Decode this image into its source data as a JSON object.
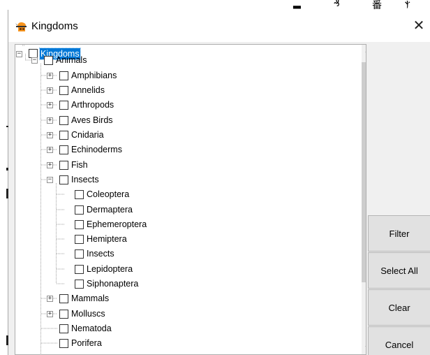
{
  "window": {
    "title": "Kingdoms",
    "close_glyph": "✕"
  },
  "tree": {
    "nodes": [
      {
        "label": "Kingdoms",
        "expander": "minus",
        "selected": true
      },
      {
        "label": "Animals",
        "expander": "minus"
      },
      {
        "label": "Amphibians",
        "expander": "plus"
      },
      {
        "label": "Annelids",
        "expander": "plus"
      },
      {
        "label": "Arthropods",
        "expander": "plus"
      },
      {
        "label": "Aves Birds",
        "expander": "plus"
      },
      {
        "label": "Cnidaria",
        "expander": "plus"
      },
      {
        "label": "Echinoderms",
        "expander": "plus"
      },
      {
        "label": "Fish",
        "expander": "plus"
      },
      {
        "label": "Insects",
        "expander": "minus"
      },
      {
        "label": "Coleoptera",
        "expander": "none"
      },
      {
        "label": "Dermaptera",
        "expander": "none"
      },
      {
        "label": "Ephemeroptera",
        "expander": "none"
      },
      {
        "label": "Hemiptera",
        "expander": "none"
      },
      {
        "label": "Insects",
        "expander": "none"
      },
      {
        "label": "Lepidoptera",
        "expander": "none"
      },
      {
        "label": "Siphonaptera",
        "expander": "none"
      },
      {
        "label": "Mammals",
        "expander": "plus"
      },
      {
        "label": "Molluscs",
        "expander": "plus"
      },
      {
        "label": "Nematoda",
        "expander": "none"
      },
      {
        "label": "Porifera",
        "expander": "none"
      }
    ]
  },
  "buttons": {
    "filter": "Filter",
    "select_all": "Select All",
    "clear": "Clear",
    "cancel": "Cancel"
  },
  "scrollbar": {
    "up": "▲",
    "down": "▼"
  },
  "colors": {
    "selection": "#0078d7",
    "dialog_bg": "#f0f0f0",
    "button_bg": "#e1e1e1",
    "icon_orange": "#f7941d"
  },
  "icons": {
    "app": "kingdoms-app-icon",
    "close": "close-icon"
  }
}
